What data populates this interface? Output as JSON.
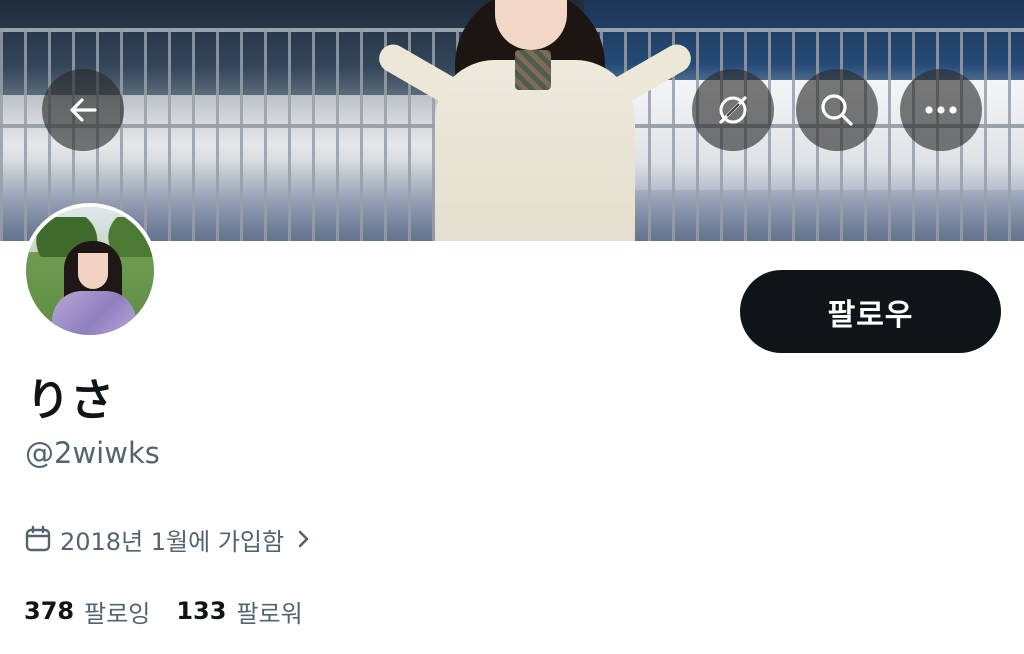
{
  "banner": {
    "image": "profile-header-photo"
  },
  "toolbar": {
    "back_icon": "arrow-left-icon",
    "grok_icon": "grok-icon",
    "search_icon": "search-icon",
    "more_icon": "more-horizontal-icon"
  },
  "profile": {
    "avatar": "profile-avatar-photo",
    "follow_label": "팔로우",
    "display_name": "りさ",
    "handle": "@2wiwks",
    "joined_text": "2018년 1월에 가입함",
    "joined_icon": "calendar-icon",
    "chevron_icon": "chevron-right-icon"
  },
  "stats": {
    "following_count": "378",
    "following_label": "팔로잉",
    "followers_count": "133",
    "followers_label": "팔로워"
  },
  "colors": {
    "text_primary": "#0f1419",
    "text_secondary": "#536471",
    "button_dark": "#0f1419",
    "overlay_button": "rgba(40,40,40,0.62)"
  }
}
